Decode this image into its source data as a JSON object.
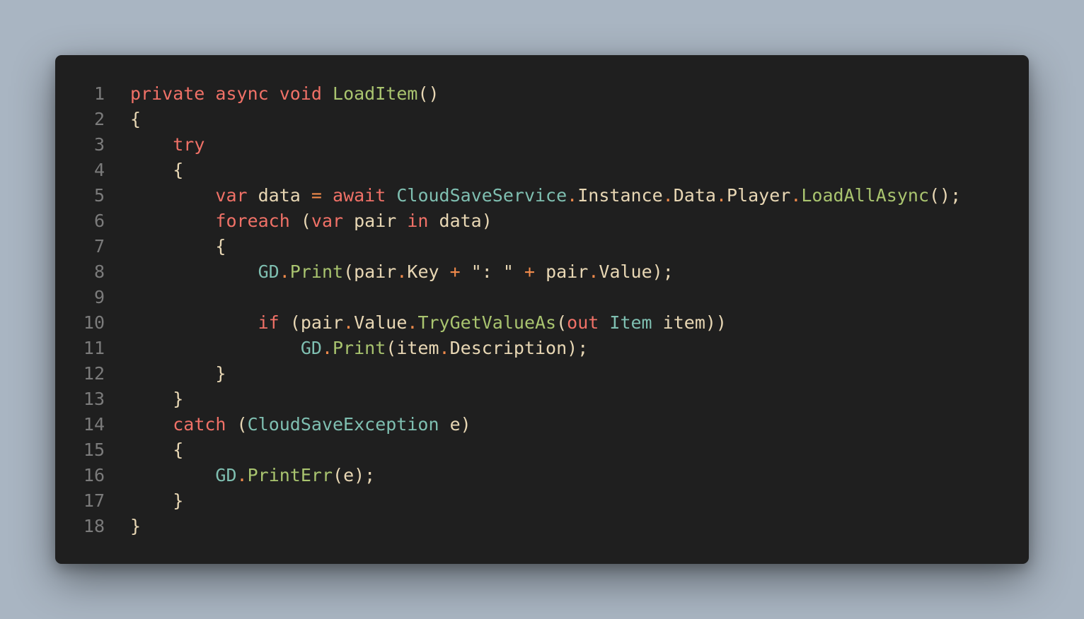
{
  "colors": {
    "page_background": "#a9b5c2",
    "editor_background": "#1f1f1f",
    "line_number": "#7b7b7b",
    "plain": "#e8d7b4",
    "keyword": "#f07167",
    "function": "#a9c46f",
    "type": "#7fbfb1",
    "operator": "#f08a4b"
  },
  "code": {
    "lines": [
      {
        "n": "1",
        "tokens": [
          [
            "kw",
            "private"
          ],
          [
            "pl",
            " "
          ],
          [
            "kw",
            "async"
          ],
          [
            "pl",
            " "
          ],
          [
            "kw",
            "void"
          ],
          [
            "pl",
            " "
          ],
          [
            "fn",
            "LoadItem"
          ],
          [
            "pl",
            "()"
          ]
        ]
      },
      {
        "n": "2",
        "tokens": [
          [
            "pl",
            "{"
          ]
        ]
      },
      {
        "n": "3",
        "tokens": [
          [
            "pl",
            "    "
          ],
          [
            "kw",
            "try"
          ]
        ]
      },
      {
        "n": "4",
        "tokens": [
          [
            "pl",
            "    {"
          ]
        ]
      },
      {
        "n": "5",
        "tokens": [
          [
            "pl",
            "        "
          ],
          [
            "kw",
            "var"
          ],
          [
            "pl",
            " data "
          ],
          [
            "op",
            "="
          ],
          [
            "pl",
            " "
          ],
          [
            "kw",
            "await"
          ],
          [
            "pl",
            " "
          ],
          [
            "ty",
            "CloudSaveService"
          ],
          [
            "op",
            "."
          ],
          [
            "pl",
            "Instance"
          ],
          [
            "op",
            "."
          ],
          [
            "pl",
            "Data"
          ],
          [
            "op",
            "."
          ],
          [
            "pl",
            "Player"
          ],
          [
            "op",
            "."
          ],
          [
            "fn",
            "LoadAllAsync"
          ],
          [
            "pl",
            "();"
          ]
        ]
      },
      {
        "n": "6",
        "tokens": [
          [
            "pl",
            "        "
          ],
          [
            "kw",
            "foreach"
          ],
          [
            "pl",
            " ("
          ],
          [
            "kw",
            "var"
          ],
          [
            "pl",
            " pair "
          ],
          [
            "kw",
            "in"
          ],
          [
            "pl",
            " data)"
          ]
        ]
      },
      {
        "n": "7",
        "tokens": [
          [
            "pl",
            "        {"
          ]
        ]
      },
      {
        "n": "8",
        "tokens": [
          [
            "pl",
            "            "
          ],
          [
            "ty",
            "GD"
          ],
          [
            "op",
            "."
          ],
          [
            "fn",
            "Print"
          ],
          [
            "pl",
            "(pair"
          ],
          [
            "op",
            "."
          ],
          [
            "pl",
            "Key "
          ],
          [
            "op",
            "+"
          ],
          [
            "pl",
            " "
          ],
          [
            "str",
            "\": \""
          ],
          [
            "pl",
            " "
          ],
          [
            "op",
            "+"
          ],
          [
            "pl",
            " pair"
          ],
          [
            "op",
            "."
          ],
          [
            "pl",
            "Value);"
          ]
        ]
      },
      {
        "n": "9",
        "tokens": []
      },
      {
        "n": "10",
        "tokens": [
          [
            "pl",
            "            "
          ],
          [
            "kw",
            "if"
          ],
          [
            "pl",
            " (pair"
          ],
          [
            "op",
            "."
          ],
          [
            "pl",
            "Value"
          ],
          [
            "op",
            "."
          ],
          [
            "fn",
            "TryGetValueAs"
          ],
          [
            "pl",
            "("
          ],
          [
            "kw",
            "out"
          ],
          [
            "pl",
            " "
          ],
          [
            "ty",
            "Item"
          ],
          [
            "pl",
            " item))"
          ]
        ]
      },
      {
        "n": "11",
        "tokens": [
          [
            "pl",
            "                "
          ],
          [
            "ty",
            "GD"
          ],
          [
            "op",
            "."
          ],
          [
            "fn",
            "Print"
          ],
          [
            "pl",
            "(item"
          ],
          [
            "op",
            "."
          ],
          [
            "pl",
            "Description);"
          ]
        ]
      },
      {
        "n": "12",
        "tokens": [
          [
            "pl",
            "        }"
          ]
        ]
      },
      {
        "n": "13",
        "tokens": [
          [
            "pl",
            "    }"
          ]
        ]
      },
      {
        "n": "14",
        "tokens": [
          [
            "pl",
            "    "
          ],
          [
            "kw",
            "catch"
          ],
          [
            "pl",
            " ("
          ],
          [
            "ty",
            "CloudSaveException"
          ],
          [
            "pl",
            " e)"
          ]
        ]
      },
      {
        "n": "15",
        "tokens": [
          [
            "pl",
            "    {"
          ]
        ]
      },
      {
        "n": "16",
        "tokens": [
          [
            "pl",
            "        "
          ],
          [
            "ty",
            "GD"
          ],
          [
            "op",
            "."
          ],
          [
            "fn",
            "PrintErr"
          ],
          [
            "pl",
            "(e);"
          ]
        ]
      },
      {
        "n": "17",
        "tokens": [
          [
            "pl",
            "    }"
          ]
        ]
      },
      {
        "n": "18",
        "tokens": [
          [
            "pl",
            "}"
          ]
        ]
      }
    ]
  }
}
